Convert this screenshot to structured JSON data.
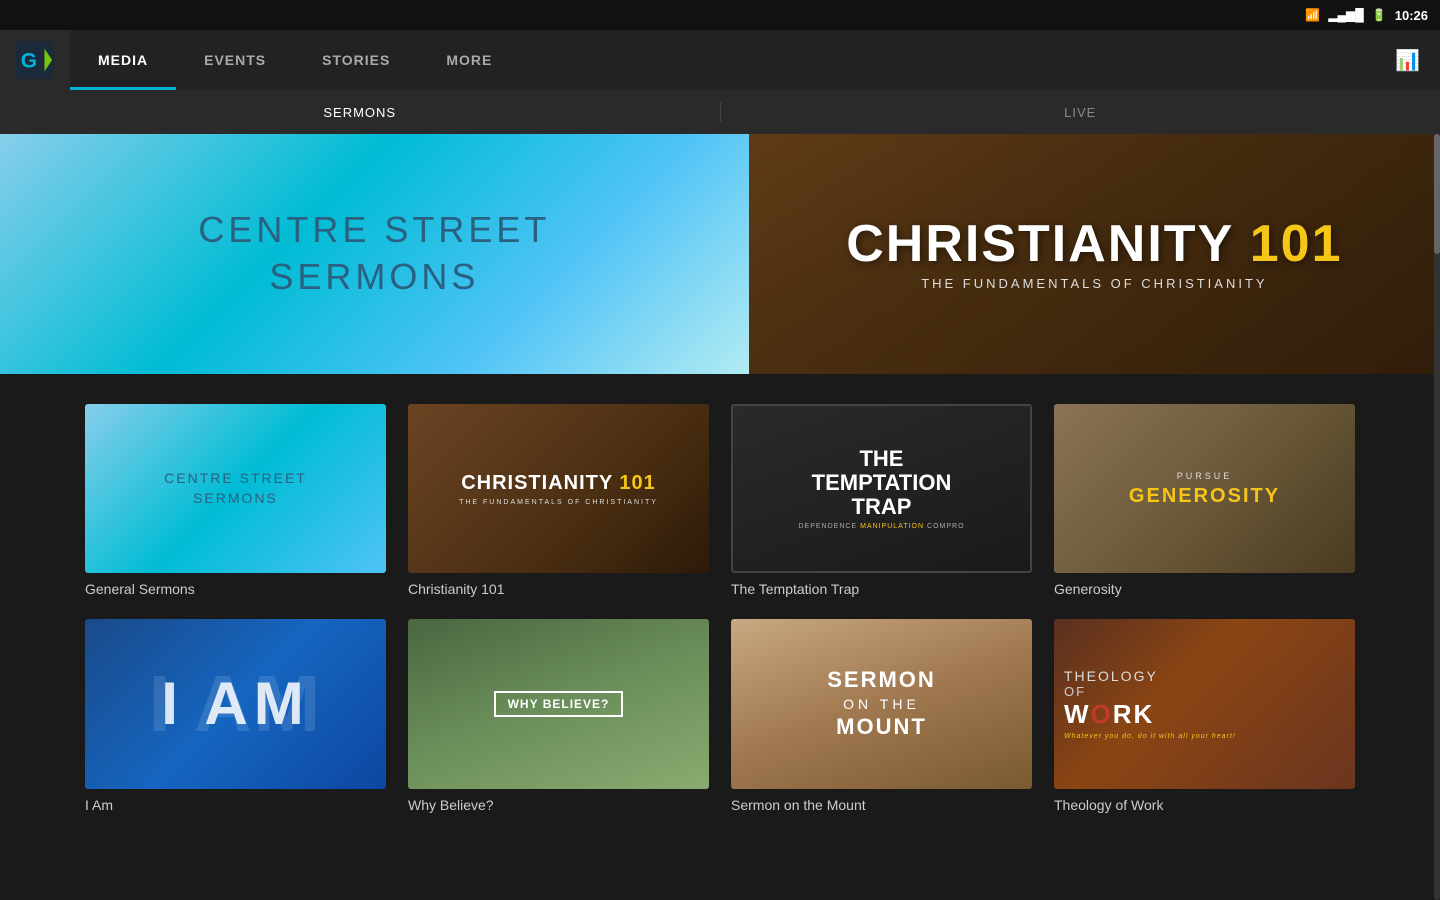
{
  "statusBar": {
    "time": "10:26",
    "wifi": "wifi",
    "signal": "signal",
    "battery": "battery"
  },
  "nav": {
    "tabs": [
      {
        "id": "media",
        "label": "MEDIA",
        "active": true
      },
      {
        "id": "events",
        "label": "EVENTS",
        "active": false
      },
      {
        "id": "stories",
        "label": "STORIES",
        "active": false
      },
      {
        "id": "more",
        "label": "MORE",
        "active": false
      }
    ]
  },
  "subNav": {
    "tabs": [
      {
        "id": "sermons",
        "label": "SERMONS",
        "active": true
      },
      {
        "id": "live",
        "label": "LIVE",
        "active": false
      }
    ]
  },
  "banner": {
    "left": {
      "line1": "CENTRE STREET",
      "line2": "SERMONS"
    },
    "right": {
      "title": "CHRISTIANITY 1",
      "numeral": "01",
      "subtitle": "THE FUNDAMENTALS OF CHRISTIANITY"
    }
  },
  "seriesGrid": {
    "row1": [
      {
        "id": "general-sermons",
        "label": "General Sermons",
        "thumbType": "general-sermons"
      },
      {
        "id": "christianity-101",
        "label": "Christianity 101",
        "thumbType": "christianity101"
      },
      {
        "id": "temptation-trap",
        "label": "The Temptation Trap",
        "thumbType": "temptation"
      },
      {
        "id": "generosity",
        "label": "Generosity",
        "thumbType": "generosity"
      }
    ],
    "row2": [
      {
        "id": "i-am",
        "label": "I Am",
        "thumbType": "iam"
      },
      {
        "id": "why-believe",
        "label": "Why Believe?",
        "thumbType": "whybelieve"
      },
      {
        "id": "sermon-mount",
        "label": "Sermon on the Mount",
        "thumbType": "sermon-mount"
      },
      {
        "id": "theology-work",
        "label": "Theology of Work",
        "thumbType": "theology"
      }
    ]
  }
}
